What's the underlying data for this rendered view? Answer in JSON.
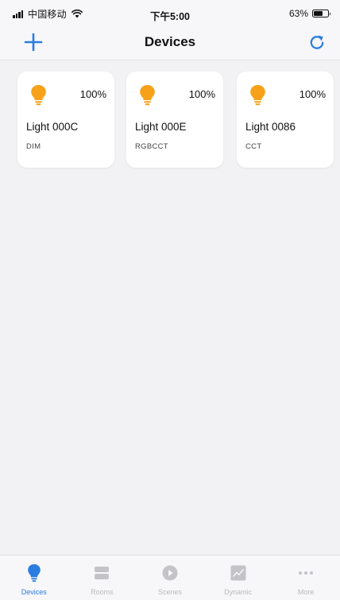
{
  "status_bar": {
    "carrier": "中国移动",
    "time": "下午5:00",
    "battery_percent_label": "63%",
    "battery_level": 0.63
  },
  "nav": {
    "title": "Devices",
    "add_icon": "plus-icon",
    "refresh_icon": "refresh-icon"
  },
  "colors": {
    "accent": "#2a7de1",
    "bulb": "#f7a11a",
    "tab_inactive": "#b9b9be"
  },
  "devices": [
    {
      "name": "Light 000C",
      "type": "DIM",
      "brightness": "100%",
      "icon": "bulb-icon"
    },
    {
      "name": "Light 000E",
      "type": "RGBCCT",
      "brightness": "100%",
      "icon": "bulb-icon"
    },
    {
      "name": "Light 0086",
      "type": "CCT",
      "brightness": "100%",
      "icon": "bulb-icon"
    }
  ],
  "tabs": [
    {
      "label": "Devices",
      "icon": "bulb-icon",
      "active": true
    },
    {
      "label": "Rooms",
      "icon": "rooms-icon",
      "active": false
    },
    {
      "label": "Scenes",
      "icon": "play-icon",
      "active": false
    },
    {
      "label": "Dynamic",
      "icon": "chart-icon",
      "active": false
    },
    {
      "label": "More",
      "icon": "more-icon",
      "active": false
    }
  ]
}
